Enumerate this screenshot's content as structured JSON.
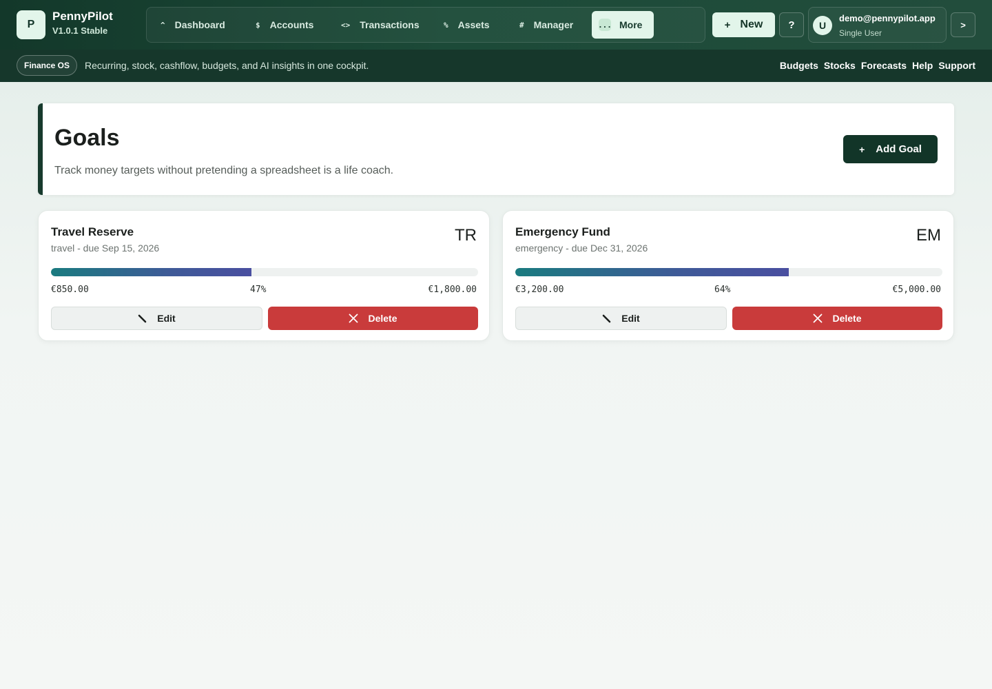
{
  "brand": {
    "logo_letter": "P",
    "name": "PennyPilot",
    "version": "V1.0.1 Stable"
  },
  "nav": {
    "items": [
      {
        "icon": "^",
        "label": "Dashboard"
      },
      {
        "icon": "$",
        "label": "Accounts"
      },
      {
        "icon": "<>",
        "label": "Transactions"
      },
      {
        "icon": "%",
        "label": "Assets"
      },
      {
        "icon": "#",
        "label": "Manager"
      },
      {
        "icon": "...",
        "label": "More",
        "active": true
      }
    ]
  },
  "toolbar": {
    "new_label": "New",
    "new_icon": "+",
    "help_label": "?",
    "collapse_label": ">"
  },
  "user": {
    "avatar_letter": "U",
    "email": "demo@pennypilot.app",
    "role": "Single User"
  },
  "subbar": {
    "badge": "Finance OS",
    "tagline": "Recurring, stock, cashflow, budgets, and AI insights in one cockpit.",
    "links": [
      "Budgets",
      "Stocks",
      "Forecasts",
      "Help",
      "Support"
    ]
  },
  "page": {
    "title": "Goals",
    "subtitle": "Track money targets without pretending a spreadsheet is a life coach.",
    "add_button_label": "Add Goal",
    "add_button_icon": "+"
  },
  "goals": [
    {
      "name": "Travel Reserve",
      "meta": "travel - due Sep 15, 2026",
      "initials": "TR",
      "current": "€850.00",
      "percent_label": "47%",
      "progress": 0.47,
      "target": "€1,800.00",
      "edit_label": "Edit",
      "delete_label": "Delete"
    },
    {
      "name": "Emergency Fund",
      "meta": "emergency - due Dec 31, 2026",
      "initials": "EM",
      "current": "€3,200.00",
      "percent_label": "64%",
      "progress": 0.64,
      "target": "€5,000.00",
      "edit_label": "Edit",
      "delete_label": "Delete"
    }
  ],
  "colors": {
    "brand_dark": "#123528",
    "accent_light": "#e2f5ea",
    "danger": "#c93b3b",
    "progress_start": "#1a7b7f",
    "progress_end": "#4a4fa0"
  }
}
